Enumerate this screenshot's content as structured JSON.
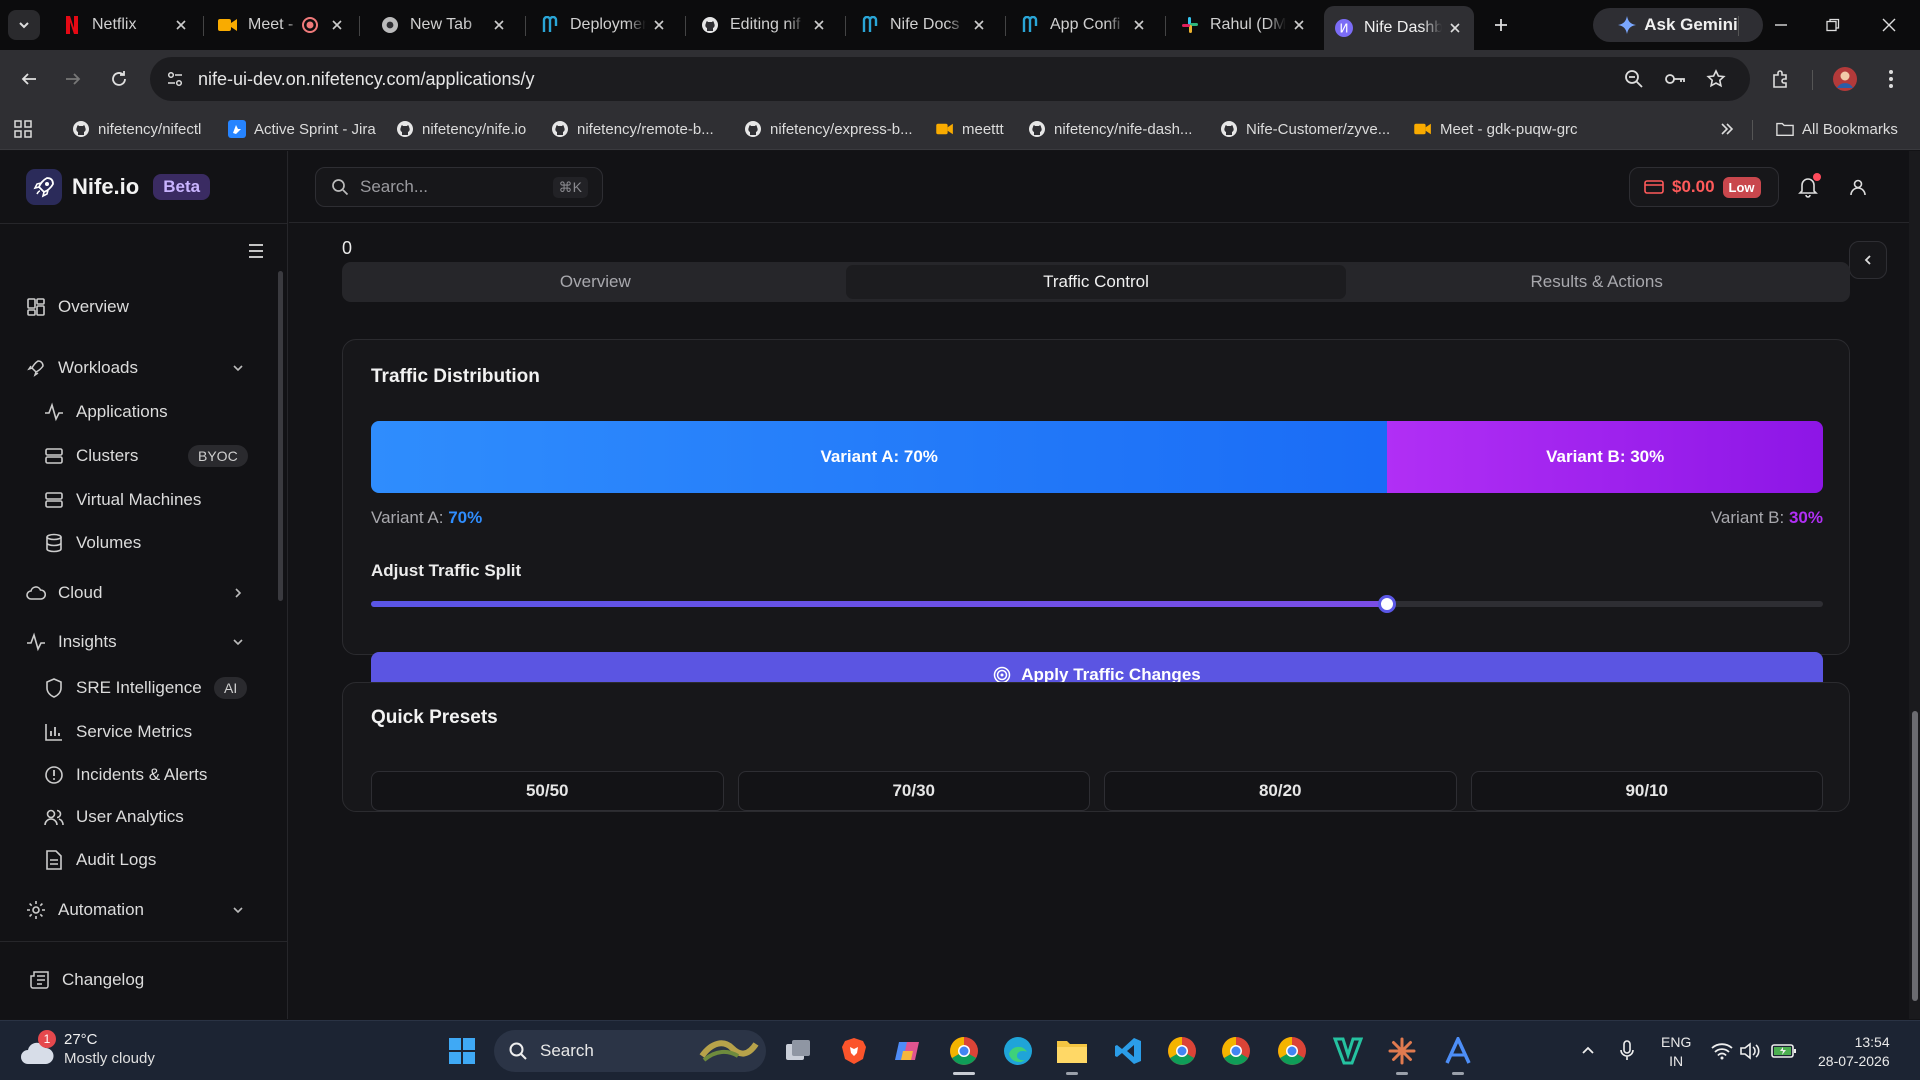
{
  "browser": {
    "tabs": [
      {
        "title": "Netflix",
        "icon": "netflix-icon"
      },
      {
        "title": "Meet -",
        "icon": "meet-icon"
      },
      {
        "title": "New Tab",
        "icon": "chrome-icon"
      },
      {
        "title": "Deployment",
        "icon": "nife-icon"
      },
      {
        "title": "Editing nif",
        "icon": "github-icon"
      },
      {
        "title": "Nife Docs",
        "icon": "nife-icon"
      },
      {
        "title": "App Confi",
        "icon": "nife-icon"
      },
      {
        "title": "Rahul (DM",
        "icon": "slack-icon"
      },
      {
        "title": "Nife Dashb",
        "icon": "nife-dashboard-icon"
      }
    ],
    "ask_gemini": "Ask Gemini",
    "url": "nife-ui-dev.on.nifetency.com/applications/y",
    "bookmarks": [
      {
        "label": "nifetency/nifectl",
        "icon": "github-icon"
      },
      {
        "label": "Active Sprint - Jira",
        "icon": "jira-icon"
      },
      {
        "label": "nifetency/nife.io",
        "icon": "github-icon"
      },
      {
        "label": "nifetency/remote-b...",
        "icon": "github-icon"
      },
      {
        "label": "nifetency/express-b...",
        "icon": "github-icon"
      },
      {
        "label": "meettt",
        "icon": "meet-icon"
      },
      {
        "label": "nifetency/nife-dash...",
        "icon": "github-icon"
      },
      {
        "label": "Nife-Customer/zyve...",
        "icon": "github-icon"
      },
      {
        "label": "Meet - gdk-puqw-grc",
        "icon": "meet-icon"
      }
    ],
    "all_bookmarks": "All Bookmarks"
  },
  "app": {
    "brand": "Nife.io",
    "beta": "Beta",
    "search_placeholder": "Search...",
    "search_shortcut": "⌘K",
    "balance": "$0.00",
    "balance_badge": "Low"
  },
  "sidebar": {
    "overview": "Overview",
    "workloads": "Workloads",
    "applications": "Applications",
    "clusters": "Clusters",
    "clusters_badge": "BYOC",
    "virtual_machines": "Virtual Machines",
    "volumes": "Volumes",
    "cloud": "Cloud",
    "insights": "Insights",
    "sre": "SRE Intelligence",
    "sre_badge": "AI",
    "service_metrics": "Service Metrics",
    "incidents": "Incidents & Alerts",
    "user_analytics": "User Analytics",
    "audit_logs": "Audit Logs",
    "automation": "Automation",
    "changelog": "Changelog"
  },
  "main": {
    "stray_value": "0",
    "tabs": [
      "Overview",
      "Traffic Control",
      "Results & Actions"
    ],
    "active_tab": "Traffic Control",
    "traffic": {
      "title": "Traffic Distribution",
      "variant_a_bar": "Variant A: 70%",
      "variant_b_bar": "Variant B: 30%",
      "variant_a_label": "Variant A: ",
      "variant_a_value": "70%",
      "variant_b_label": "Variant B: ",
      "variant_b_value": "30%",
      "variant_a_percent": 70,
      "variant_b_percent": 30,
      "adjust_label": "Adjust Traffic Split",
      "slider_value": 70,
      "apply_button": "Apply Traffic Changes",
      "color_a": "#2f8dfd",
      "color_b": "#b12ff5"
    },
    "presets": {
      "title": "Quick Presets",
      "options": [
        "50/50",
        "70/30",
        "80/20",
        "90/10"
      ]
    }
  },
  "taskbar": {
    "weather_badge": "1",
    "temperature": "27°C",
    "condition": "Mostly cloudy",
    "search": "Search",
    "lang_line1": "ENG",
    "lang_line2": "IN",
    "time": "13:54",
    "date": "28-07-2026"
  }
}
